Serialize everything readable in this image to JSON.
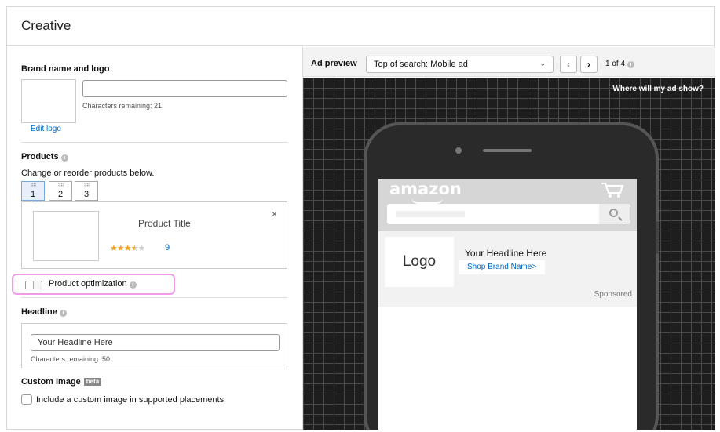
{
  "card": {
    "title": "Creative"
  },
  "brand": {
    "label": "Brand name and logo",
    "input_value": "",
    "chars_remaining": "Characters remaining: 21",
    "edit_logo": "Edit logo"
  },
  "products": {
    "label": "Products",
    "instructions": "Change or reorder products below.",
    "tabs": [
      {
        "grip": "⠿⠿",
        "label": "1",
        "active": true
      },
      {
        "grip": "⠿⠿",
        "label": "2",
        "active": false
      },
      {
        "grip": "⠿⠿",
        "label": "3",
        "active": false
      }
    ],
    "card": {
      "title": "Product Title",
      "close": "×",
      "rating": 3.5,
      "stars": [
        "★",
        "★",
        "★",
        "★",
        "★"
      ],
      "rating_count": "9"
    }
  },
  "optimization": {
    "label": "Product optimization"
  },
  "headline": {
    "label": "Headline",
    "input_value": "Your Headline Here",
    "chars_remaining": "Characters remaining: 50"
  },
  "custom_image": {
    "label": "Custom Image",
    "badge": "beta",
    "checkbox_label": "Include a custom image in supported placements"
  },
  "preview": {
    "label": "Ad preview",
    "selected_option": "Top of search: Mobile ad",
    "prev": "‹",
    "next": "›",
    "page_text": "1 of 4",
    "where_show": "Where will my ad show?",
    "phone": {
      "brand_logo_text": "amazon",
      "ad_logo": "Logo",
      "ad_headline": "Your Headline Here",
      "ad_shop": "Shop Brand Name>",
      "sponsored": "Sponsored"
    }
  },
  "colors": {
    "link": "#0066c0",
    "highlight": "#f09be8",
    "star": "#f0a020",
    "preview_bg": "#1e1e1e"
  }
}
